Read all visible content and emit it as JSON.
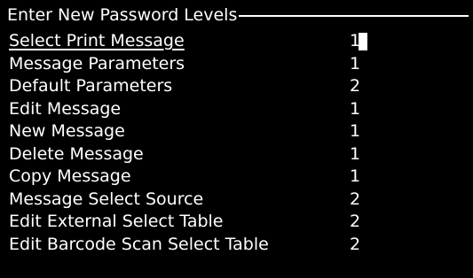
{
  "header": {
    "title": "Enter New Password Levels"
  },
  "rows": [
    {
      "label": "Select Print Message",
      "level": "1"
    },
    {
      "label": "Message Parameters",
      "level": "1"
    },
    {
      "label": "Default Parameters",
      "level": "2"
    },
    {
      "label": "Edit Message",
      "level": "1"
    },
    {
      "label": "New Message",
      "level": "1"
    },
    {
      "label": "Delete Message",
      "level": "1"
    },
    {
      "label": "Copy Message",
      "level": "1"
    },
    {
      "label": "Message Select Source",
      "level": "2"
    },
    {
      "label": "Edit External Select Table",
      "level": "2"
    },
    {
      "label": "Edit Barcode Scan Select Table",
      "level": "2"
    }
  ],
  "colors": {
    "background": "#000000",
    "text": "#ffffff"
  }
}
